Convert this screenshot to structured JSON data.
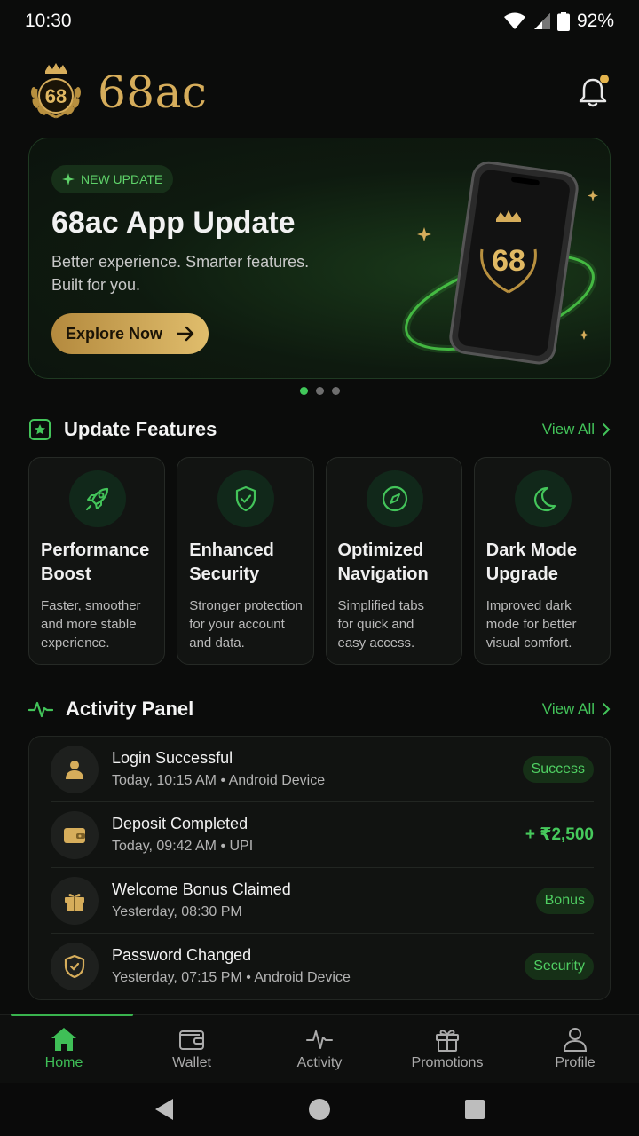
{
  "status_bar": {
    "time": "10:30",
    "battery": "92%"
  },
  "header": {
    "brand_logo_text": "68",
    "brand_name": "68ac"
  },
  "hero": {
    "badge": "NEW UPDATE",
    "title": "68ac App Update",
    "subtitle_line1": "Better experience. Smarter features.",
    "subtitle_line2": "Built for you.",
    "cta_label": "Explore Now",
    "phone_logo_text": "68",
    "carousel_pages": 3,
    "carousel_active": 1
  },
  "features": {
    "title": "Update Features",
    "view_all": "View All",
    "items": [
      {
        "icon": "rocket-icon",
        "title_line1": "Performance",
        "title_line2": "Boost",
        "desc_line1": "Faster, smoother",
        "desc_line2": "and more stable",
        "desc_line3": "experience."
      },
      {
        "icon": "shield-check-icon",
        "title_line1": "Enhanced",
        "title_line2": "Security",
        "desc_line1": "Stronger protection",
        "desc_line2": "for your account",
        "desc_line3": "and data."
      },
      {
        "icon": "compass-icon",
        "title_line1": "Optimized",
        "title_line2": "Navigation",
        "desc_line1": "Simplified tabs",
        "desc_line2": "for quick and",
        "desc_line3": "easy access."
      },
      {
        "icon": "moon-icon",
        "title_line1": "Dark Mode",
        "title_line2": "Upgrade",
        "desc_line1": "Improved dark",
        "desc_line2": "mode for better",
        "desc_line3": "visual comfort."
      }
    ]
  },
  "activity": {
    "title": "Activity Panel",
    "view_all": "View All",
    "items": [
      {
        "icon": "user-icon",
        "title": "Login Successful",
        "meta": "Today, 10:15 AM • Android Device",
        "status": "Success"
      },
      {
        "icon": "wallet-icon",
        "title": "Deposit Completed",
        "meta": "Today, 09:42 AM • UPI",
        "amount": "+ ₹2,500"
      },
      {
        "icon": "gift-icon",
        "title": "Welcome Bonus Claimed",
        "meta": "Yesterday, 08:30 PM",
        "status": "Bonus"
      },
      {
        "icon": "shield-icon",
        "title": "Password Changed",
        "meta": "Yesterday, 07:15 PM • Android Device",
        "status": "Security"
      }
    ]
  },
  "nav": {
    "items": [
      {
        "label": "Home",
        "icon": "home-icon"
      },
      {
        "label": "Wallet",
        "icon": "wallet-icon"
      },
      {
        "label": "Activity",
        "icon": "activity-icon"
      },
      {
        "label": "Promotions",
        "icon": "gift-icon"
      },
      {
        "label": "Profile",
        "icon": "user-icon"
      }
    ],
    "active": "Home"
  },
  "colors": {
    "accent_green": "#43c45a",
    "gold": "#d6ad5b",
    "background": "#0b0c0b"
  }
}
